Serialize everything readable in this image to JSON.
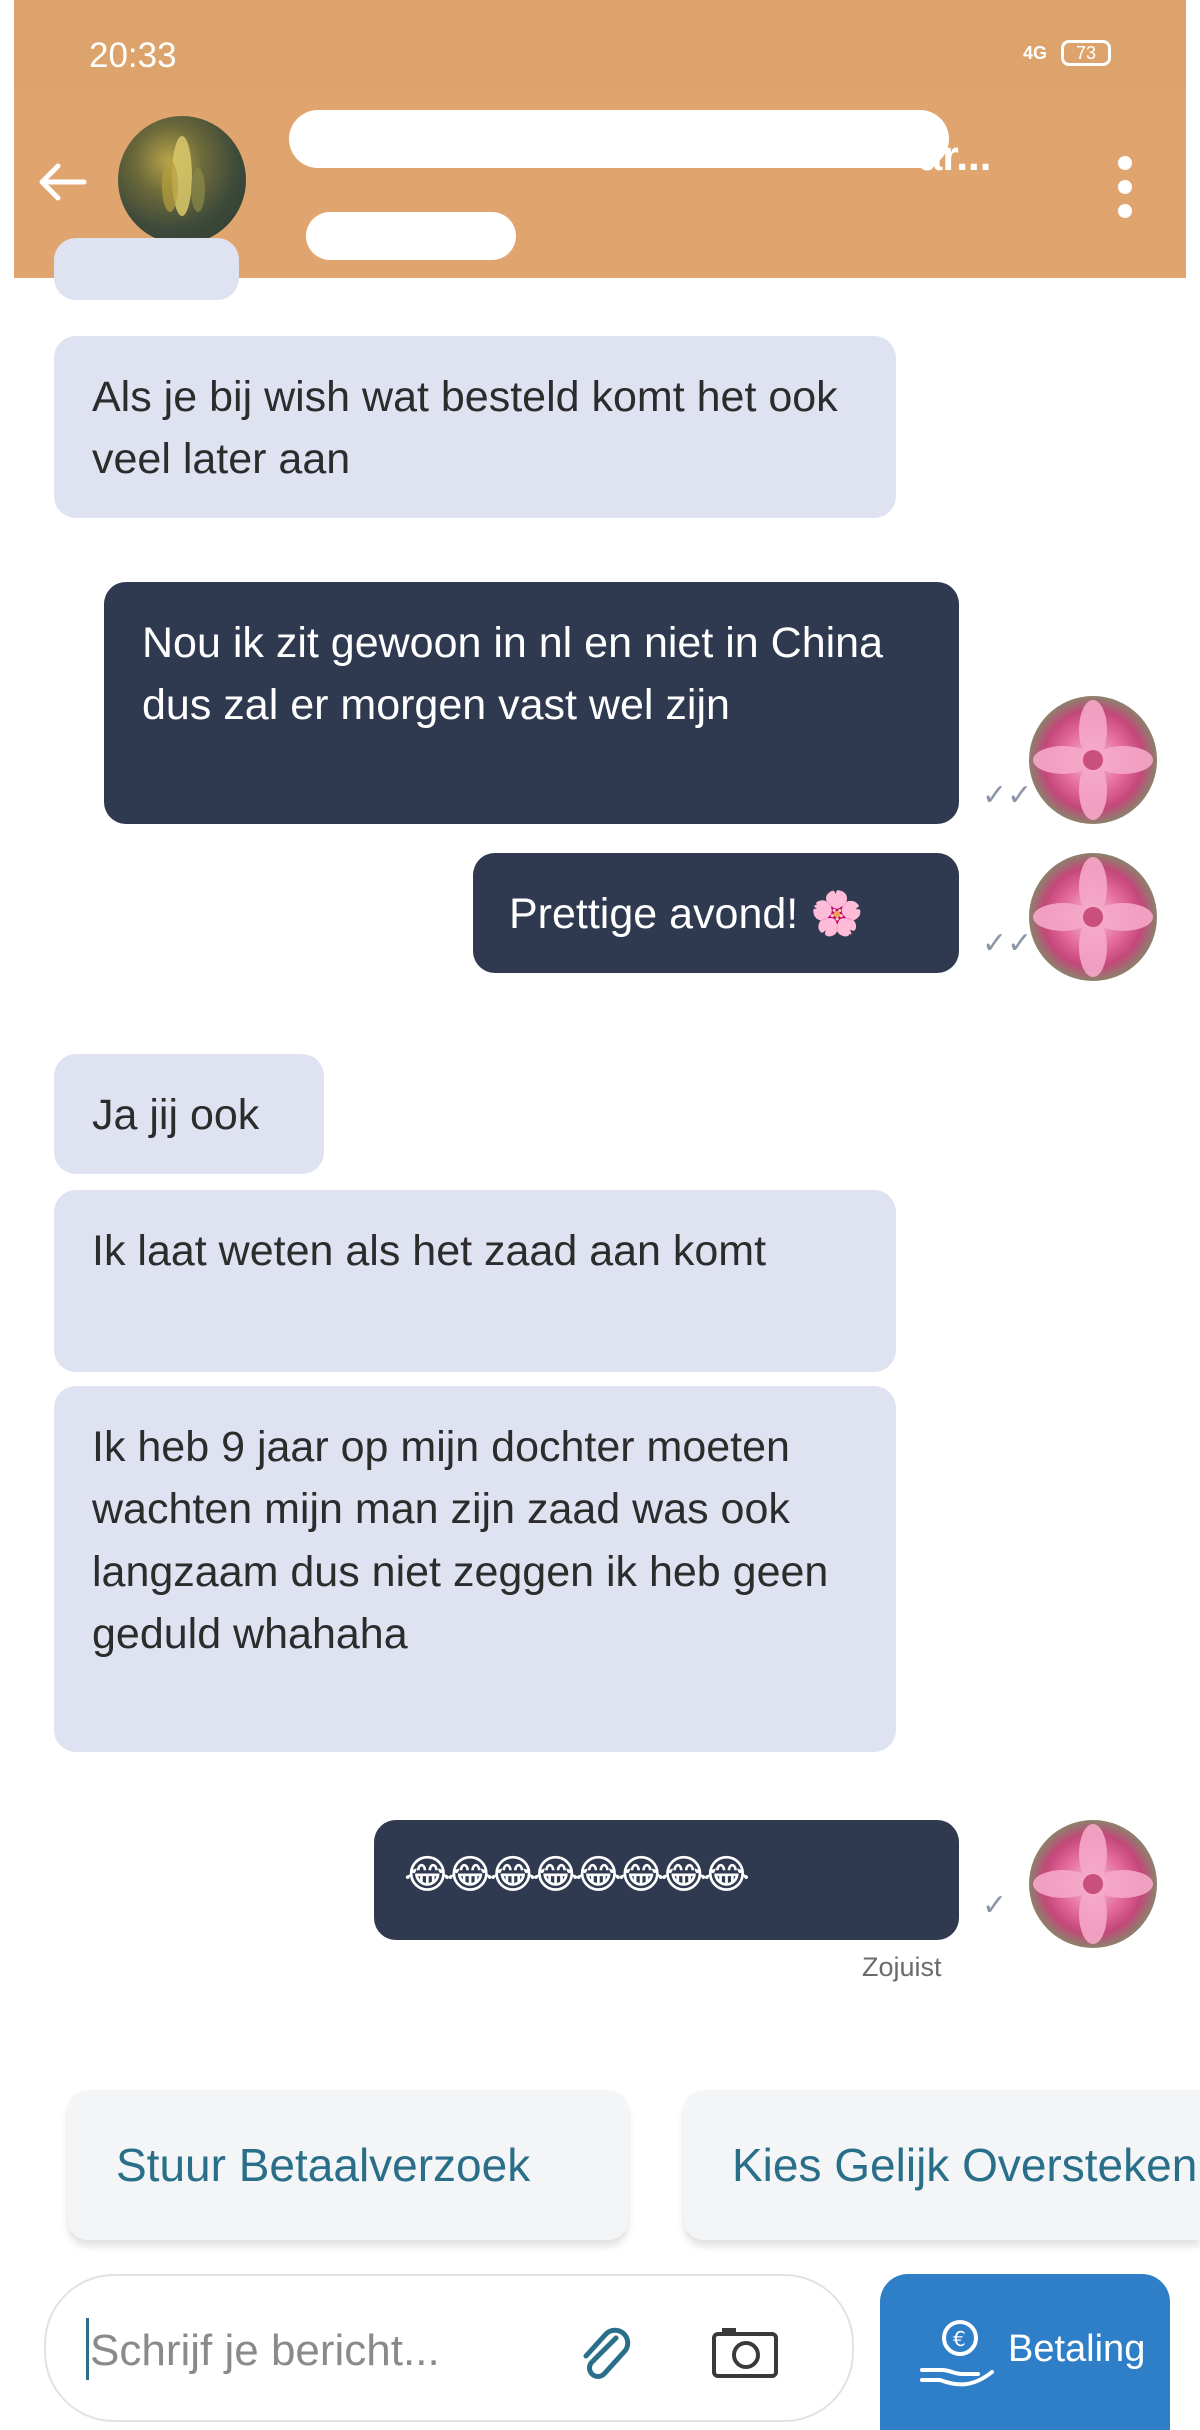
{
  "status_bar": {
    "time": "20:33",
    "signal": "4G",
    "battery": "73"
  },
  "header": {
    "contact_name_visible": "ar..."
  },
  "messages": {
    "m0": "Als je bij wish wat besteld komt het ook veel later aan",
    "m1": "Nou ik zit gewoon in nl en niet in China dus zal er morgen vast wel zijn",
    "m2": "Prettige avond! 🌸",
    "m3": "Ja jij ook",
    "m4": "Ik laat weten als het zaad aan komt",
    "m5": "Ik heb 9 jaar op mijn dochter moeten wachten mijn man zijn zaad was ook langzaam dus niet zeggen ik heb geen geduld whahaha",
    "m6": "😂😂😂😂😂😂😂😂",
    "m6_time": "Zojuist"
  },
  "quick_actions": {
    "payment_request": "Stuur Betaalverzoek",
    "exchange": "Kies Gelijk Oversteken"
  },
  "composer": {
    "placeholder": "Schrijf je bericht...",
    "pay_label": "Betaling"
  },
  "colors": {
    "header": "#e0a56e",
    "received_bubble": "#dfe2f1",
    "sent_bubble": "#2f3a50",
    "accent": "#2e7ec8"
  }
}
